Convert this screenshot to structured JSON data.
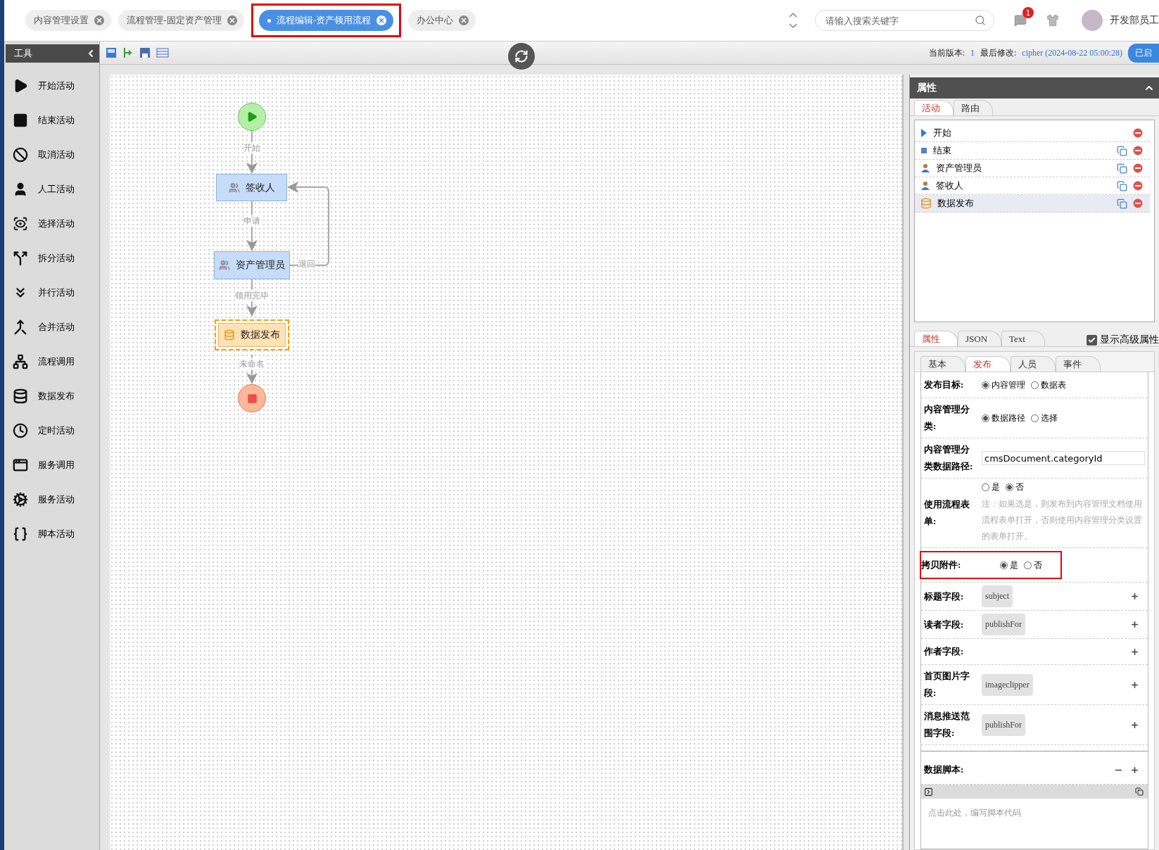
{
  "header": {
    "tabs": [
      {
        "label": "内容管理设置",
        "selected": false,
        "highlighted": false
      },
      {
        "label": "流程管理-固定资产管理",
        "selected": false,
        "highlighted": false
      },
      {
        "label": "流程编辑-资产领用流程",
        "selected": true,
        "highlighted": true
      },
      {
        "label": "办公中心",
        "selected": false,
        "highlighted": false
      }
    ],
    "search": {
      "placeholder": "请输入搜索关键字"
    },
    "notifications": "1",
    "user": "开发部员工"
  },
  "tools": {
    "title": "工具",
    "items": [
      {
        "label": "开始活动",
        "kind": "start"
      },
      {
        "label": "结束活动",
        "kind": "end"
      },
      {
        "label": "取消活动",
        "kind": "cancel"
      },
      {
        "label": "人工活动",
        "kind": "manual"
      },
      {
        "label": "选择活动",
        "kind": "choice"
      },
      {
        "label": "拆分活动",
        "kind": "split"
      },
      {
        "label": "并行活动",
        "kind": "parallel"
      },
      {
        "label": "合并活动",
        "kind": "merge"
      },
      {
        "label": "流程调用",
        "kind": "subprocess"
      },
      {
        "label": "数据发布",
        "kind": "publish"
      },
      {
        "label": "定时活动",
        "kind": "timer"
      },
      {
        "label": "服务调用",
        "kind": "service_call"
      },
      {
        "label": "服务活动",
        "kind": "service"
      },
      {
        "label": "脚本活动",
        "kind": "script"
      }
    ]
  },
  "toolbar": {
    "version_label": "当前版本:",
    "version": "1",
    "modified_label": "最后修改:",
    "modified": "cipher (2024-08-22 05:00:28)",
    "status": "已启"
  },
  "diagram": {
    "nodes": [
      {
        "kind": "start"
      },
      {
        "kind": "manual",
        "label": "签收人",
        "selected": false
      },
      {
        "kind": "manual",
        "label": "资产管理员",
        "selected": false
      },
      {
        "kind": "publish",
        "label": "数据发布",
        "selected": true
      },
      {
        "kind": "end"
      }
    ],
    "edges": [
      {
        "label": "开始"
      },
      {
        "label": "申请"
      },
      {
        "label": "退回"
      },
      {
        "label": "领用完毕"
      },
      {
        "label": "未命名"
      }
    ]
  },
  "properties": {
    "title": "属性",
    "tabs": [
      {
        "label": "活动",
        "selected": true
      },
      {
        "label": "路由",
        "selected": false
      }
    ],
    "activities": [
      {
        "name": "开始",
        "kind": "start",
        "copyable": false,
        "selected": false
      },
      {
        "name": "结束",
        "kind": "end",
        "copyable": true,
        "selected": false
      },
      {
        "name": "资产管理员",
        "kind": "manual",
        "copyable": true,
        "selected": false
      },
      {
        "name": "签收人",
        "kind": "manual",
        "copyable": true,
        "selected": false
      },
      {
        "name": "数据发布",
        "kind": "publish",
        "copyable": true,
        "selected": true
      }
    ],
    "view_tabs": [
      {
        "label": "属性",
        "selected": true
      },
      {
        "label": "JSON",
        "selected": false
      },
      {
        "label": "Text",
        "selected": false
      }
    ],
    "advanced": {
      "label": "显示高级属性",
      "checked": true
    },
    "sub_tabs": [
      {
        "label": "基本",
        "selected": false
      },
      {
        "label": "发布",
        "selected": true
      },
      {
        "label": "人员",
        "selected": false
      },
      {
        "label": "事件",
        "selected": false
      }
    ],
    "form": [
      {
        "kind": "radio",
        "label": "发布目标:",
        "highlighted": false,
        "options": [
          {
            "label": "内容管理",
            "selected": true
          },
          {
            "label": "数据表",
            "selected": false
          }
        ]
      },
      {
        "kind": "radio",
        "label": "内容管理分类:",
        "highlighted": false,
        "options": [
          {
            "label": "数据路径",
            "selected": true
          },
          {
            "label": "选择",
            "selected": false
          }
        ]
      },
      {
        "kind": "text",
        "label": "内容管理分类数据路径:",
        "value": "cmsDocument.categoryId"
      },
      {
        "kind": "radio",
        "label": "使用流程表单:",
        "highlighted": false,
        "options": [
          {
            "label": "是",
            "selected": false
          },
          {
            "label": "否",
            "selected": true
          }
        ],
        "note": "注：如果选是，则发布到内容管理文档使用流程表单打开，否则使用内容管理分类设置的表单打开。"
      },
      {
        "kind": "radio",
        "label": "拷贝附件:",
        "highlighted": true,
        "options": [
          {
            "label": "是",
            "selected": true
          },
          {
            "label": "否",
            "selected": false
          }
        ]
      },
      {
        "kind": "field",
        "label": "标题字段:",
        "value": "subject"
      },
      {
        "kind": "field",
        "label": "读者字段:",
        "value": "publishFor"
      },
      {
        "kind": "field",
        "label": "作者字段:"
      },
      {
        "kind": "field",
        "label": "首页图片字段:",
        "value": "imageclipper"
      },
      {
        "kind": "field",
        "label": "消息推送范围字段:",
        "value": "publishFor"
      }
    ],
    "script": {
      "label": "数据脚本:",
      "placeholder": "点击此处，编写脚本代码"
    }
  }
}
